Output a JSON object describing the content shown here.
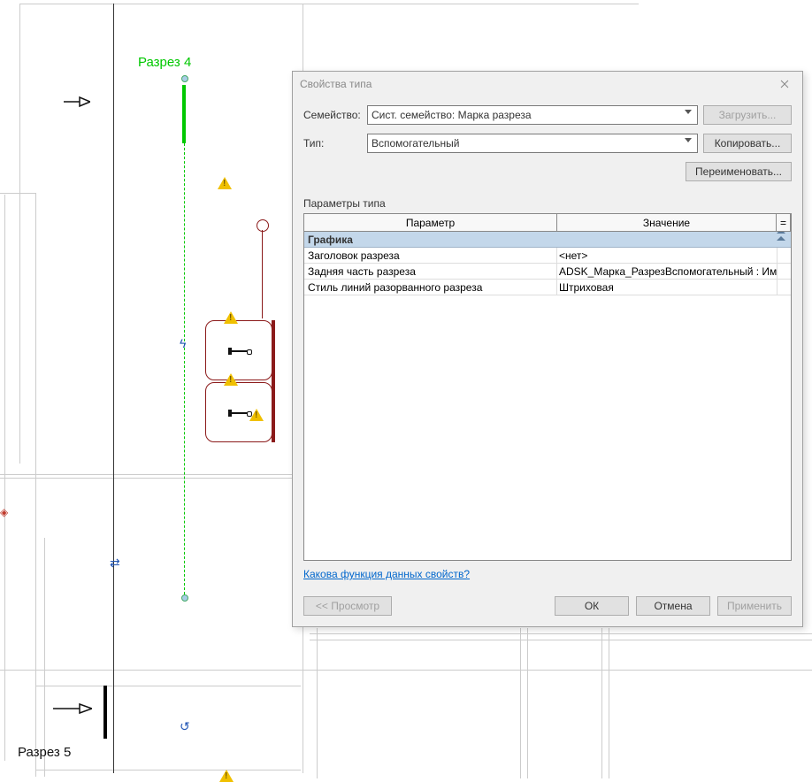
{
  "canvas": {
    "section_label_top": "Разрез 4",
    "section_label_bottom": "Разрез 5"
  },
  "dialog": {
    "title": "Свойства типа",
    "family_label": "Семейство:",
    "family_value": "Сист. семейство: Марка разреза",
    "type_label": "Тип:",
    "type_value": "Вспомогательный",
    "buttons": {
      "load": "Загрузить...",
      "copy": "Копировать...",
      "rename": "Переименовать..."
    },
    "params_title": "Параметры типа",
    "grid": {
      "header_param": "Параметр",
      "header_value": "Значение",
      "header_eq": "=",
      "group": "Графика",
      "rows": [
        {
          "param": "Заголовок разреза",
          "value": "<нет>"
        },
        {
          "param": "Задняя часть разреза",
          "value": "ADSK_Марка_РазрезВспомогательный : Имя в"
        },
        {
          "param": "Стиль линий разорванного разреза",
          "value": "Штриховая"
        }
      ]
    },
    "help_link": "Какова функция данных свойств?",
    "footer": {
      "preview": "<< Просмотр",
      "ok": "ОК",
      "cancel": "Отмена",
      "apply": "Применить"
    }
  }
}
